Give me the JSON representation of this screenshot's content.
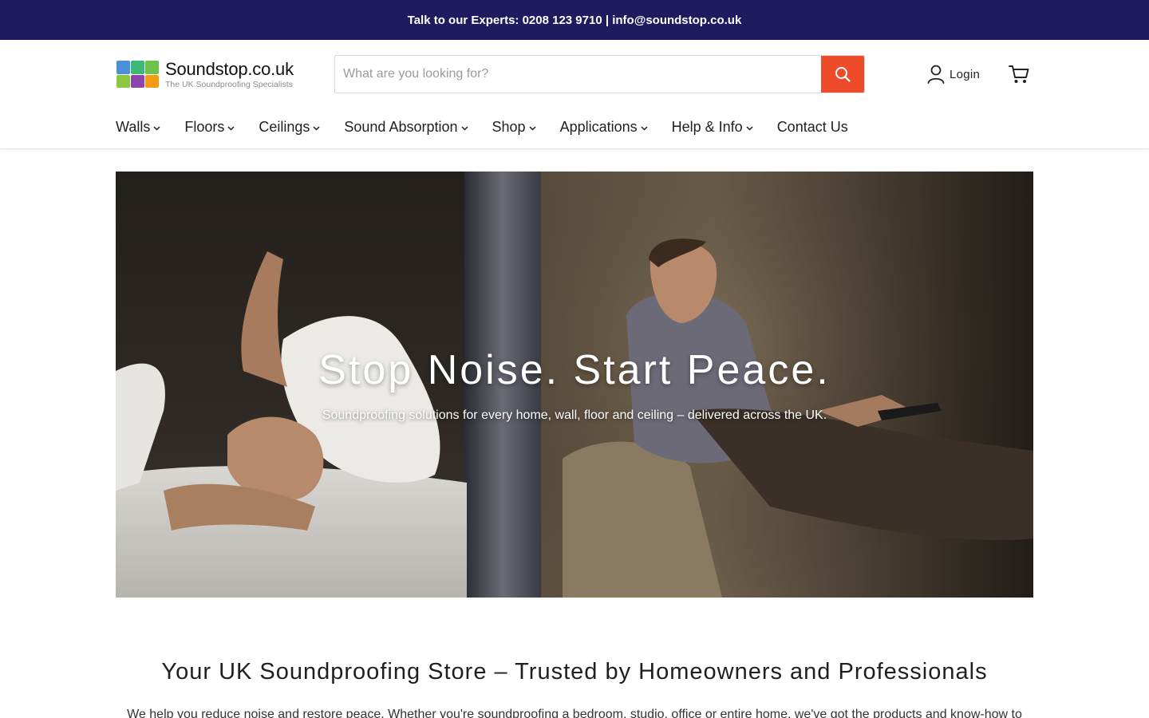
{
  "topbar": {
    "text": "Talk to our Experts: 0208 123 9710 | info@soundstop.co.uk"
  },
  "header": {
    "logo": {
      "name": "Soundstop.co.uk",
      "tagline": "The UK Soundproofing Specialists",
      "colors": [
        "#4a90d9",
        "#3cb878",
        "#6cc24a",
        "#8dc63f",
        "#8e44ad",
        "#f39c12"
      ]
    },
    "search": {
      "placeholder": "What are you looking for?",
      "value": "",
      "button_color": "#ee4b2b"
    },
    "login_label": "Login",
    "icons": {
      "search": "search-icon",
      "login": "user-icon",
      "cart": "cart-icon"
    }
  },
  "nav": {
    "items": [
      {
        "label": "Walls",
        "has_dropdown": true
      },
      {
        "label": "Floors",
        "has_dropdown": true
      },
      {
        "label": "Ceilings",
        "has_dropdown": true
      },
      {
        "label": "Sound Absorption",
        "has_dropdown": true
      },
      {
        "label": "Shop",
        "has_dropdown": true
      },
      {
        "label": "Applications",
        "has_dropdown": true
      },
      {
        "label": "Help & Info",
        "has_dropdown": true
      },
      {
        "label": "Contact Us",
        "has_dropdown": false
      }
    ]
  },
  "hero": {
    "title": "Stop Noise. Start Peace.",
    "subtitle": "Soundproofing solutions for every home, wall, floor and ceiling – delivered across the UK."
  },
  "intro": {
    "title": "Your UK Soundproofing Store – Trusted by Homeowners and Professionals",
    "body": "We help you reduce noise and restore peace. Whether you're soundproofing a bedroom, studio, office or entire home, we've got the products and know-how to"
  },
  "colors": {
    "topbar": "#1e1b5e",
    "accent": "#ee4b2b"
  }
}
